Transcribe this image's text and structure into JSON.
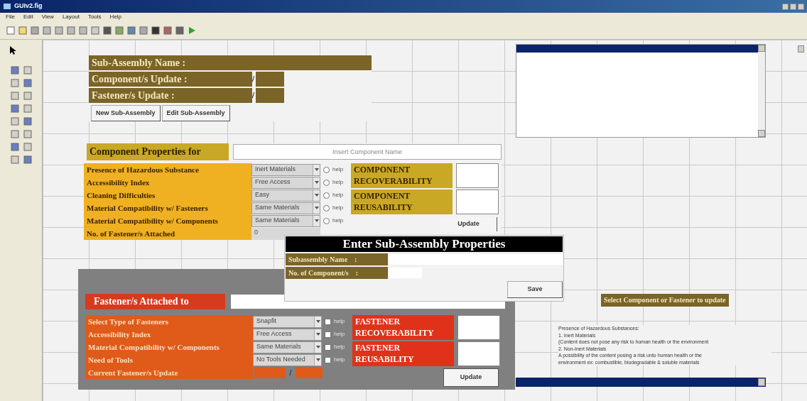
{
  "window": {
    "title": "GUIv2.fig"
  },
  "menu": [
    "File",
    "Edit",
    "View",
    "Layout",
    "Tools",
    "Help"
  ],
  "header": {
    "rows": [
      {
        "kind": "name",
        "label": "Sub-Assembly Name  :"
      },
      {
        "kind": "ratio",
        "label": "Component/s Update :",
        "separator": "/"
      },
      {
        "kind": "ratio",
        "label": "Fastener/s Update    :",
        "separator": "/"
      }
    ],
    "buttons": [
      "New Sub-Assembly",
      "Edit Sub-Assembly"
    ]
  },
  "component": {
    "title": "Component Properties for",
    "name_placeholder": "Insert Component Name",
    "rows": [
      {
        "kind": "select",
        "label": "Presence of Hazardous Substance",
        "value": "Inert Materials",
        "help": "help",
        "help_checked": false
      },
      {
        "kind": "select",
        "label": "Accessibility Index",
        "value": "Free Access",
        "help": "help",
        "help_checked": false
      },
      {
        "kind": "select",
        "label": "Cleaning Difficulties",
        "value": "Easy",
        "help": "help",
        "help_checked": false
      },
      {
        "kind": "select",
        "label": "Material Compatibility w/ Fasteners",
        "value": "Same Materials",
        "help": "help",
        "help_checked": false
      },
      {
        "kind": "select",
        "label": "Material Compatibility w/ Components",
        "value": "Same Materials",
        "help": "help",
        "help_checked": false
      },
      {
        "kind": "text",
        "label": "No. of Fastener/s Attached",
        "value": "0"
      }
    ],
    "results": [
      "COMPONENT RECOVERABILITY",
      "COMPONENT REUSABILITY"
    ],
    "update": "Update"
  },
  "fastener": {
    "title": "Fastener/s Attached to",
    "rows": [
      {
        "kind": "select",
        "label": "Select Type of Fasteners",
        "value": "Snapfit",
        "help": "help",
        "help_checked": false
      },
      {
        "kind": "select",
        "label": "Accessibility Index",
        "value": "Free Access",
        "help": "help",
        "help_checked": false
      },
      {
        "kind": "select",
        "label": "Material Compatibility w/ Components",
        "value": "Same Materials",
        "help": "help",
        "help_checked": false
      },
      {
        "kind": "select",
        "label": "Need of Tools",
        "value": "No Tools Needed",
        "help": "help",
        "help_checked": false
      },
      {
        "kind": "ratio",
        "label": "Current Fastener/s Update",
        "separator": "/"
      }
    ],
    "results": [
      "FASTENER RECOVERABILITY",
      "FASTENER REUSABILITY"
    ],
    "update": "Update"
  },
  "dialog": {
    "title": "Enter Sub-Assembly Properties",
    "fields": [
      "Subassembly Name    :",
      "No. of Component/s    :"
    ],
    "save": "Save"
  },
  "select_label": "Select Component or Fastener to update",
  "help_text": [
    "Presence of Hazardous Substances:",
    "1. Inert Materials",
    "(Content does not pose any risk to human health or the environment",
    "2. Non-Inert Materials",
    "A possibility of the content posing a risk unto human health or the",
    "environment ex: combustible, biodegradable & soluble materials"
  ]
}
